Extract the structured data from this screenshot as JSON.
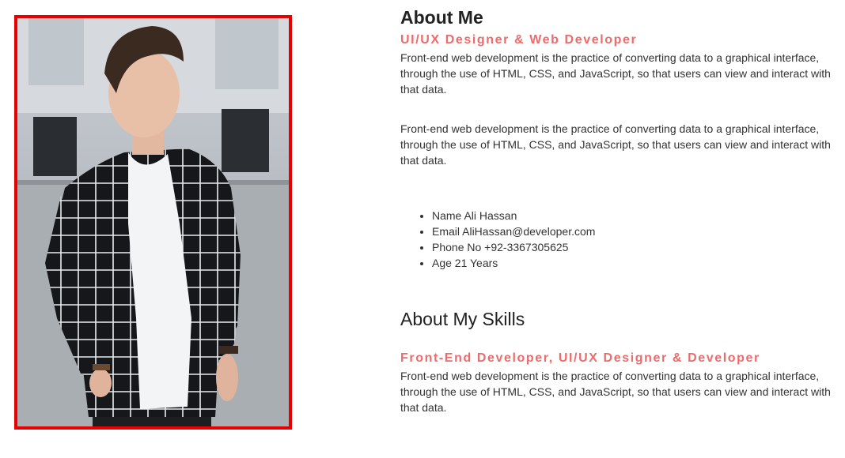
{
  "photo": {
    "alt": "Portrait of a young man in a black and white checked shirt"
  },
  "about": {
    "title": "About Me",
    "role": "UI/UX Designer & Web Developer",
    "paragraphs": [
      "Front-end web development is the practice of converting data to a graphical interface, through the use of HTML, CSS, and JavaScript, so that users can view and interact with that data.",
      "Front-end web development is the practice of converting data to a graphical interface, through the use of HTML, CSS, and JavaScript, so that users can view and interact with that data."
    ],
    "details": [
      "Name Ali Hassan",
      "Email AliHassan@developer.com",
      "Phone No +92-3367305625",
      "Age 21 Years"
    ]
  },
  "skills": {
    "title": "About My Skills",
    "role": "Front-End Developer, UI/UX Designer & Developer",
    "paragraph": "Front-end web development is the practice of converting data to a graphical interface, through the use of HTML, CSS, and JavaScript, so that users can view and interact with that data."
  },
  "colors": {
    "accent": "#ee6b6b",
    "photo_border": "#e60000",
    "text": "#333333"
  }
}
